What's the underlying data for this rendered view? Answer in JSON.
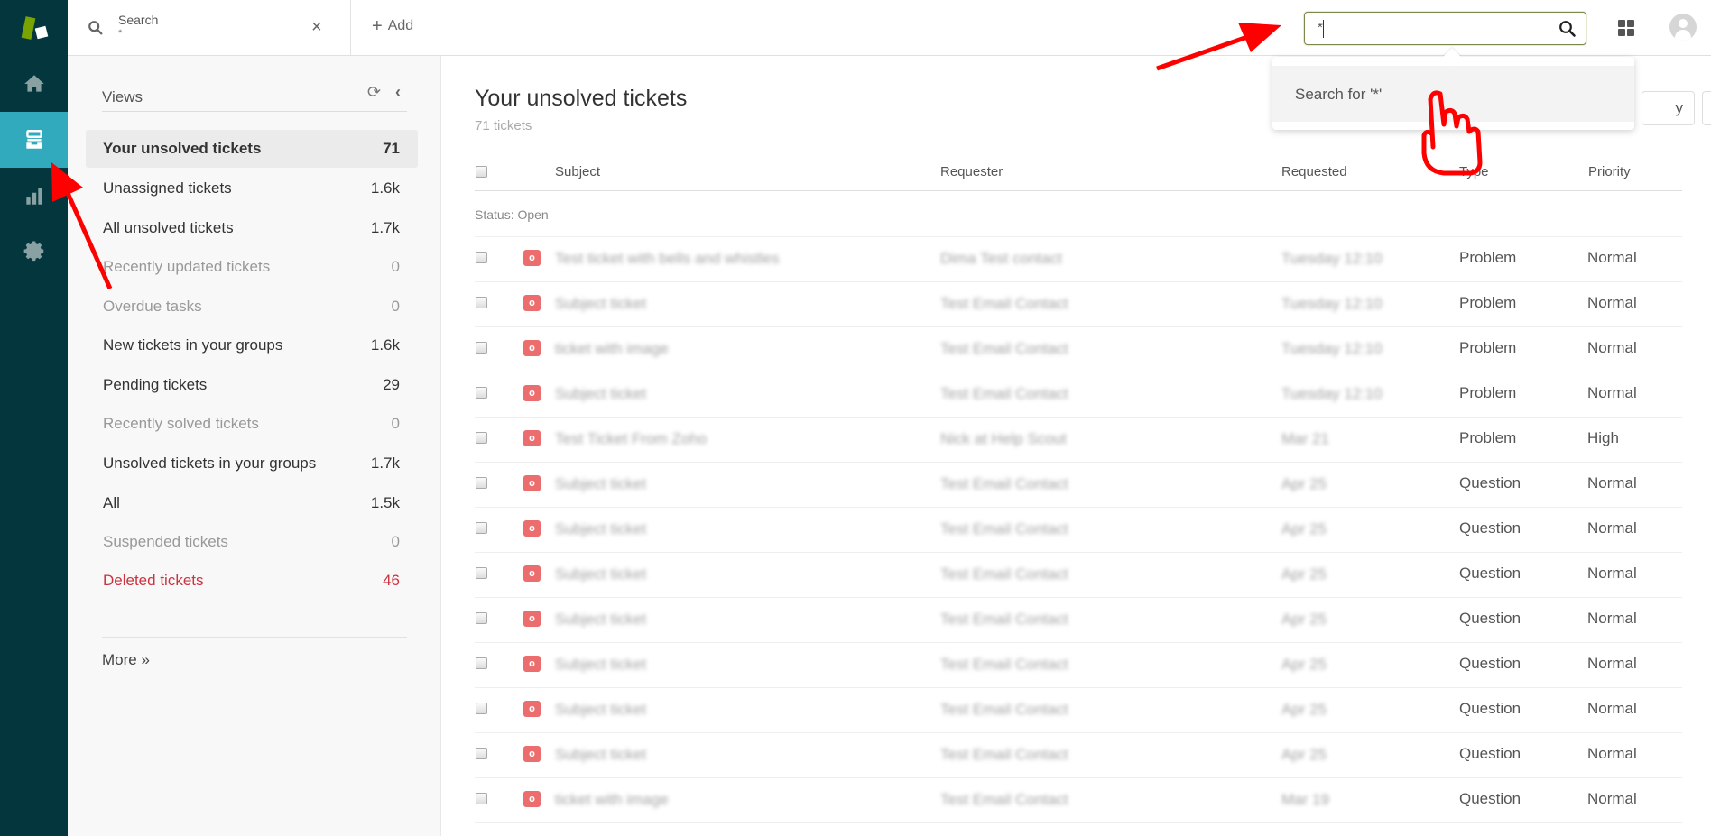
{
  "leftnav": {
    "items": [
      {
        "name": "home",
        "icon": "home-icon"
      },
      {
        "name": "views",
        "icon": "tickets-icon",
        "active": true
      },
      {
        "name": "reporting",
        "icon": "bar-chart-icon"
      },
      {
        "name": "admin",
        "icon": "gear-icon"
      }
    ]
  },
  "topbar": {
    "tab": {
      "label": "Search",
      "sublabel": "*",
      "close": "×"
    },
    "add_label": "Add",
    "search": {
      "value": "*"
    },
    "icons": [
      "products-grid-icon",
      "user-avatar-icon"
    ]
  },
  "search_dropdown": {
    "option": "Search for '*'"
  },
  "views": {
    "title": "Views",
    "items": [
      {
        "label": "Your unsolved tickets",
        "count": "71",
        "state": "active"
      },
      {
        "label": "Unassigned tickets",
        "count": "1.6k",
        "state": "normal"
      },
      {
        "label": "All unsolved tickets",
        "count": "1.7k",
        "state": "normal"
      },
      {
        "label": "Recently updated tickets",
        "count": "0",
        "state": "muted"
      },
      {
        "label": "Overdue tasks",
        "count": "0",
        "state": "muted"
      },
      {
        "label": "New tickets in your groups",
        "count": "1.6k",
        "state": "normal"
      },
      {
        "label": "Pending tickets",
        "count": "29",
        "state": "normal"
      },
      {
        "label": "Recently solved tickets",
        "count": "0",
        "state": "muted"
      },
      {
        "label": "Unsolved tickets in your groups",
        "count": "1.7k",
        "state": "normal"
      },
      {
        "label": "All",
        "count": "1.5k",
        "state": "normal"
      },
      {
        "label": "Suspended tickets",
        "count": "0",
        "state": "muted"
      },
      {
        "label": "Deleted tickets",
        "count": "46",
        "state": "danger"
      }
    ],
    "more": "More »"
  },
  "main": {
    "title": "Your unsolved tickets",
    "subtitle": "71 tickets",
    "play_visible_fragment": "y",
    "columns": {
      "subject": "Subject",
      "requester": "Requester",
      "requested": "Requested",
      "type": "Type",
      "priority": "Priority"
    },
    "group_label": "Status: Open",
    "status_badge": "o",
    "rows": [
      {
        "subject": "Test ticket with bells and whistles",
        "requester": "Dima Test contact",
        "requested": "Tuesday 12:10",
        "type": "Problem",
        "priority": "Normal"
      },
      {
        "subject": "Subject ticket",
        "requester": "Test Email Contact",
        "requested": "Tuesday 12:10",
        "type": "Problem",
        "priority": "Normal"
      },
      {
        "subject": "ticket with image",
        "requester": "Test Email Contact",
        "requested": "Tuesday 12:10",
        "type": "Problem",
        "priority": "Normal"
      },
      {
        "subject": "Subject ticket",
        "requester": "Test Email Contact",
        "requested": "Tuesday 12:10",
        "type": "Problem",
        "priority": "Normal"
      },
      {
        "subject": "Test Ticket From Zoho",
        "requester": "Nick at Help Scout",
        "requested": "Mar 21",
        "type": "Problem",
        "priority": "High"
      },
      {
        "subject": "Subject ticket",
        "requester": "Test Email Contact",
        "requested": "Apr 25",
        "type": "Question",
        "priority": "Normal"
      },
      {
        "subject": "Subject ticket",
        "requester": "Test Email Contact",
        "requested": "Apr 25",
        "type": "Question",
        "priority": "Normal"
      },
      {
        "subject": "Subject ticket",
        "requester": "Test Email Contact",
        "requested": "Apr 25",
        "type": "Question",
        "priority": "Normal"
      },
      {
        "subject": "Subject ticket",
        "requester": "Test Email Contact",
        "requested": "Apr 25",
        "type": "Question",
        "priority": "Normal"
      },
      {
        "subject": "Subject ticket",
        "requester": "Test Email Contact",
        "requested": "Apr 25",
        "type": "Question",
        "priority": "Normal"
      },
      {
        "subject": "Subject ticket",
        "requester": "Test Email Contact",
        "requested": "Apr 25",
        "type": "Question",
        "priority": "Normal"
      },
      {
        "subject": "Subject ticket",
        "requester": "Test Email Contact",
        "requested": "Apr 25",
        "type": "Question",
        "priority": "Normal"
      },
      {
        "subject": "ticket with image",
        "requester": "Test Email Contact",
        "requested": "Mar 19",
        "type": "Question",
        "priority": "Normal"
      }
    ]
  },
  "colors": {
    "nav_bg": "#03363d",
    "nav_active": "#30aabc",
    "brand_green": "#78a300",
    "badge_open": "#eb6d6d",
    "danger": "#cc3340",
    "annotation": "#ff0000"
  }
}
